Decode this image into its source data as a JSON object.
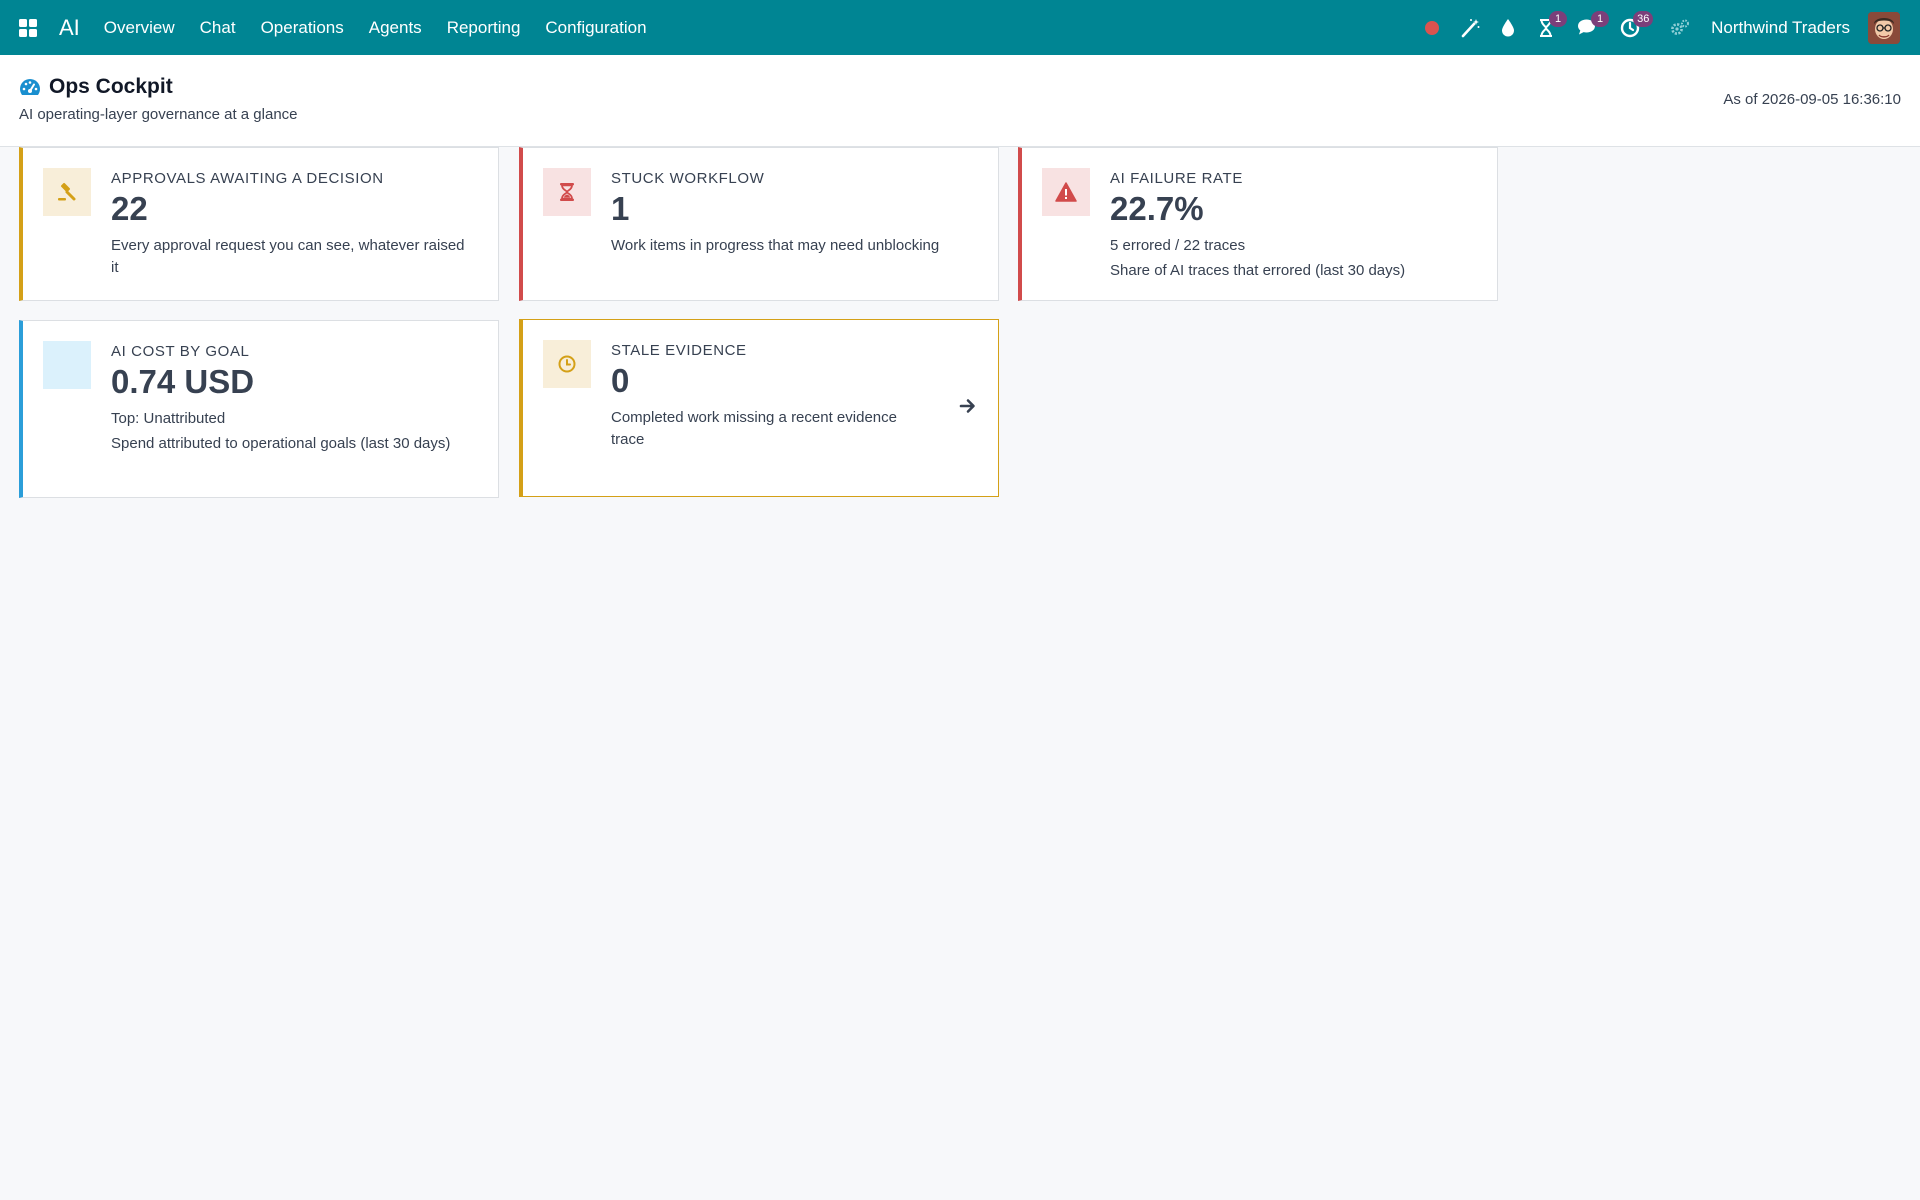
{
  "navbar": {
    "app_name": "AI",
    "menu": [
      {
        "label": "Overview"
      },
      {
        "label": "Chat"
      },
      {
        "label": "Operations"
      },
      {
        "label": "Agents"
      },
      {
        "label": "Reporting"
      },
      {
        "label": "Configuration"
      }
    ],
    "systray": {
      "activity_badge": "1",
      "messages_badge": "1",
      "clock_badge": "36"
    },
    "company": "Northwind Traders",
    "brand_color": "#008593"
  },
  "header": {
    "title": "Ops Cockpit",
    "subtitle": "AI operating-layer governance at a glance",
    "as_of": "As of 2026-09-05 16:36:10"
  },
  "cards": [
    {
      "label": "Approvals awaiting a decision",
      "value": "22",
      "detail": "Every approval request you can see, whatever raised it",
      "icon": "gavel-icon",
      "accent": "#d4a017"
    },
    {
      "label": "Stuck workflow",
      "value": "1",
      "detail": "Work items in progress that may need unblocking",
      "icon": "hourglass-icon",
      "accent": "#d14b4b"
    },
    {
      "label": "AI failure rate",
      "value": "22.7%",
      "sub": "5 errored / 22 traces",
      "detail": "Share of AI traces that errored (last 30 days)",
      "icon": "warning-icon",
      "accent": "#d14b4b"
    },
    {
      "label": "AI cost by goal",
      "value": "0.74 USD",
      "sub": "Top: Unattributed",
      "detail": "Spend attributed to operational goals (last 30 days)",
      "icon": "blank-icon",
      "accent": "#2b9ed9"
    },
    {
      "label": "Stale evidence",
      "value": "0",
      "detail": "Completed work missing a recent evidence trace",
      "icon": "clock-icon",
      "accent": "#d4a017"
    }
  ]
}
